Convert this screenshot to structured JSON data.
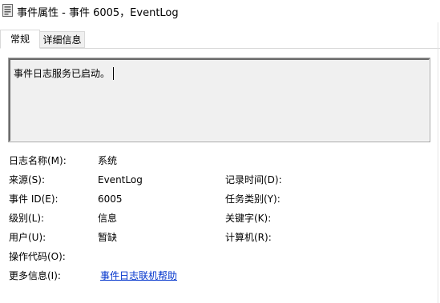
{
  "window": {
    "title": "事件属性 - 事件 6005，EventLog",
    "icon": "event-properties-icon"
  },
  "tabs": [
    {
      "label": "常规",
      "active": true
    },
    {
      "label": "详细信息",
      "active": false
    }
  ],
  "description": "事件日志服务已启动。",
  "fields": {
    "log_name": {
      "label": "日志名称(M):",
      "value": "系统"
    },
    "source": {
      "label": "来源(S):",
      "value": "EventLog"
    },
    "event_id": {
      "label": "事件 ID(E):",
      "value": "6005"
    },
    "level": {
      "label": "级别(L):",
      "value": "信息"
    },
    "user": {
      "label": "用户(U):",
      "value": "暂缺"
    },
    "opcode": {
      "label": "操作代码(O):",
      "value": ""
    },
    "more_info": {
      "label": "更多信息(I):",
      "link": "事件日志联机帮助"
    },
    "logged": {
      "label": "记录时间(D):",
      "value": ""
    },
    "task_category": {
      "label": "任务类别(Y):",
      "value": ""
    },
    "keywords": {
      "label": "关键字(K):",
      "value": ""
    },
    "computer": {
      "label": "计算机(R):",
      "value": ""
    }
  },
  "colors": {
    "link": "#0033cc",
    "desc_background": "#f0f0f0"
  }
}
